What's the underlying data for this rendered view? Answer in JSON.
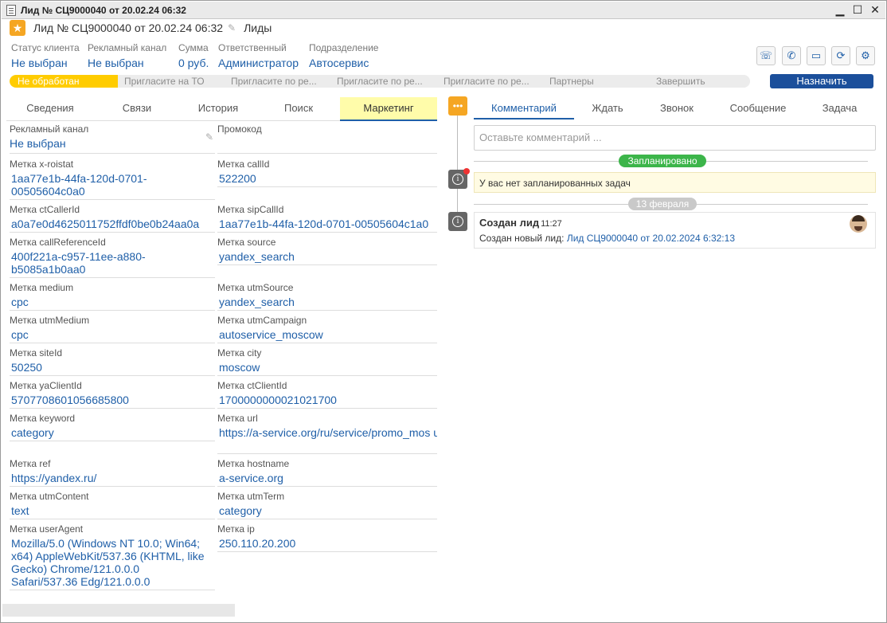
{
  "window": {
    "title": "Лид № СЦ9000040 от 20.02.24 06:32",
    "controls": [
      "▁",
      "☐",
      "✕"
    ]
  },
  "header": {
    "title": "Лид № СЦ9000040 от 20.02.24 06:32",
    "subtitle": "Лиды"
  },
  "info": [
    {
      "label": "Статус клиента",
      "value": "Не выбран"
    },
    {
      "label": "Рекламный канал",
      "value": "Не выбран"
    },
    {
      "label": "Сумма",
      "value": "0 руб."
    },
    {
      "label": "Ответственный",
      "value": "Администратор"
    },
    {
      "label": "Подразделение",
      "value": "Автосервис"
    }
  ],
  "stages": [
    "Не обработан",
    "Пригласите на ТО",
    "Пригласите по ре...",
    "Пригласите по ре...",
    "Пригласите по ре...",
    "Партнеры",
    "Завершить"
  ],
  "assign_label": "Назначить",
  "left_tabs": [
    "Сведения",
    "Связи",
    "История",
    "Поиск",
    "Маркетинг"
  ],
  "fields_left": [
    {
      "label": "Рекламный канал",
      "value": "Не выбран"
    },
    {
      "label": "Метка x-roistat",
      "value": "1aa77e1b-44fa-120d-0701-\n00505604c0a0"
    },
    {
      "label": "Метка ctCallerId",
      "value": "a0a7e0d4625011752ffdf0be0b24aa0a"
    },
    {
      "label": "Метка callReferenceId",
      "value": "400f221a-c957-11ee-a880-\nb5085a1b0aa0"
    },
    {
      "label": "Метка medium",
      "value": "cpc"
    },
    {
      "label": "Метка utmMedium",
      "value": "cpc"
    },
    {
      "label": "Метка siteId",
      "value": "50250"
    },
    {
      "label": "Метка yaClientId",
      "value": "5707708601056685800"
    },
    {
      "label": "Метка keyword",
      "value": "category"
    },
    {
      "label": "Метка ref",
      "value": "https://yandex.ru/"
    },
    {
      "label": "Метка utmContent",
      "value": "text"
    },
    {
      "label": "Метка userAgent",
      "value": "Mozilla/5.0 (Windows NT 10.0; Win64;\nx64) AppleWebKit/537.36 (KHTML, like\nGecko) Chrome/121.0.0.0\nSafari/537.36 Edg/121.0.0.0"
    }
  ],
  "fields_right": [
    {
      "label": "Промокод",
      "value": ""
    },
    {
      "label": "Метка callId",
      "value": "522200"
    },
    {
      "label": "Метка sipCallId",
      "value": "1aa77e1b-44fa-120d-0701-00505604c1a0"
    },
    {
      "label": "Метка source",
      "value": "yandex_search"
    },
    {
      "label": "Метка utmSource",
      "value": "yandex_search"
    },
    {
      "label": "Метка utmCampaign",
      "value": "autoservice_moscow"
    },
    {
      "label": "Метка city",
      "value": "moscow"
    },
    {
      "label": "Метка ctClientId",
      "value": "1700000000021021700"
    },
    {
      "label": "Метка url",
      "value": "https://a-service.org/ru/service/promo_mos\nutm_source=yandex_search&utm_medium="
    },
    {
      "label": "Метка hostname",
      "value": "a-service.org"
    },
    {
      "label": "Метка utmTerm",
      "value": "category"
    },
    {
      "label": "Метка ip",
      "value": "250.110.20.200"
    }
  ],
  "right_tabs": [
    "Комментарий",
    "Ждать",
    "Звонок",
    "Сообщение",
    "Задача"
  ],
  "comment_placeholder": "Оставьте комментарий ...",
  "planned_label": "Запланировано",
  "no_tasks": "У вас нет запланированных задач",
  "date_label": "13 февраля",
  "lead_event": {
    "title": "Создан лид",
    "time": "11:27",
    "text": "Создан новый лид:",
    "link": "Лид СЦ9000040 от 20.02.2024 6:32:13"
  },
  "colors": {
    "accent": "#1f5fa8",
    "stage_active": "#ffcc00",
    "assign": "#1b4f9b",
    "planned": "#3cb54a",
    "tab_active_bg": "#fffcaa"
  }
}
